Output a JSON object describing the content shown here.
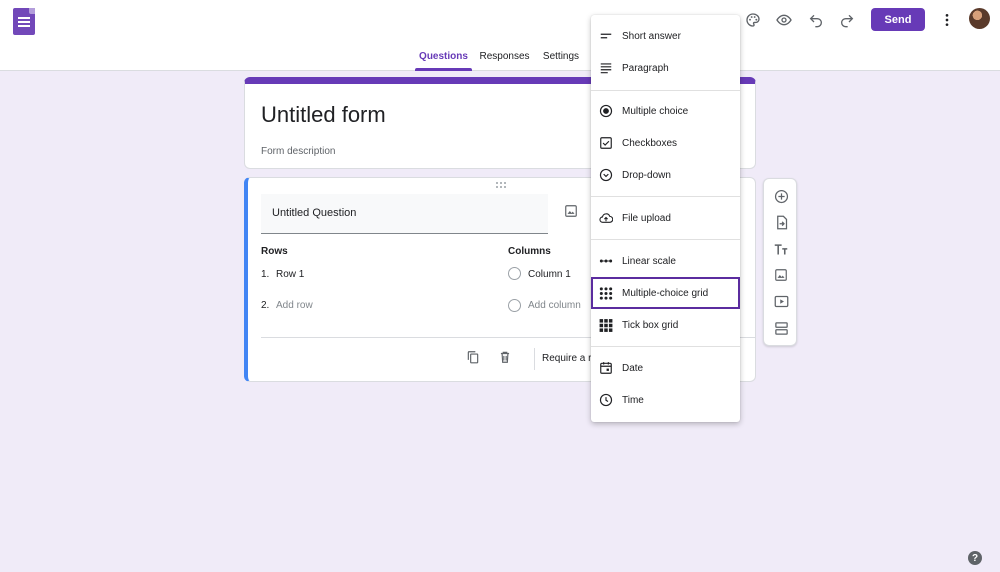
{
  "header": {
    "send_label": "Send",
    "tabs": [
      {
        "label": "Questions"
      },
      {
        "label": "Responses"
      },
      {
        "label": "Settings"
      }
    ]
  },
  "form": {
    "title": "Untitled form",
    "description_placeholder": "Form description"
  },
  "question": {
    "title": "Untitled Question",
    "rows_header": "Rows",
    "columns_header": "Columns",
    "rows": [
      {
        "num": "1.",
        "label": "Row 1"
      },
      {
        "num": "2.",
        "label": "Add row"
      }
    ],
    "columns": [
      {
        "label": "Column 1"
      },
      {
        "label": "Add column"
      }
    ],
    "require_label": "Require a re"
  },
  "menu": {
    "items": [
      {
        "label": "Short answer",
        "icon": "short-answer-icon"
      },
      {
        "label": "Paragraph",
        "icon": "paragraph-icon"
      },
      {
        "label": "Multiple choice",
        "icon": "radio-button-icon"
      },
      {
        "label": "Checkboxes",
        "icon": "checkbox-icon"
      },
      {
        "label": "Drop-down",
        "icon": "dropdown-circle-icon"
      },
      {
        "label": "File upload",
        "icon": "cloud-upload-icon"
      },
      {
        "label": "Linear scale",
        "icon": "linear-scale-icon"
      },
      {
        "label": "Multiple-choice grid",
        "icon": "dots-grid-icon"
      },
      {
        "label": "Tick box grid",
        "icon": "squares-grid-icon"
      },
      {
        "label": "Date",
        "icon": "calendar-icon"
      },
      {
        "label": "Time",
        "icon": "clock-icon"
      }
    ],
    "selected": "Multiple-choice grid"
  },
  "help_label": "?",
  "colors": {
    "accent": "#673ab7",
    "background": "#f0ebf8",
    "active_question_border": "#4285f4"
  }
}
